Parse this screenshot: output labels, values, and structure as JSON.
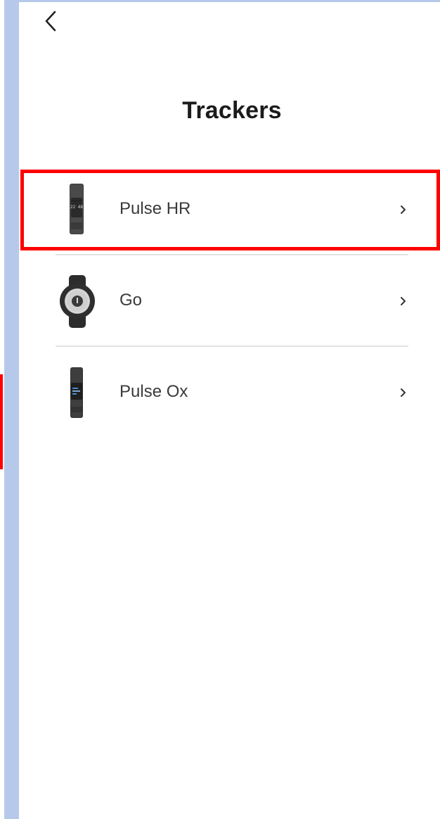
{
  "header": {
    "title": "Trackers",
    "back_icon": "chevron-left-icon"
  },
  "trackers": [
    {
      "label": "Pulse HR",
      "image": "pulse-hr-band",
      "chevron_icon": "chevron-right-icon",
      "display_text": "22 48"
    },
    {
      "label": "Go",
      "image": "go-round-tracker",
      "chevron_icon": "chevron-right-icon"
    },
    {
      "label": "Pulse Ox",
      "image": "pulse-ox-band",
      "chevron_icon": "chevron-right-icon"
    }
  ],
  "colors": {
    "highlight": "#ff0000",
    "side_strip": "#b7c9ea",
    "divider": "#e3e3e3",
    "title_text": "#1b1b1b",
    "item_text": "#3a3a3a"
  }
}
